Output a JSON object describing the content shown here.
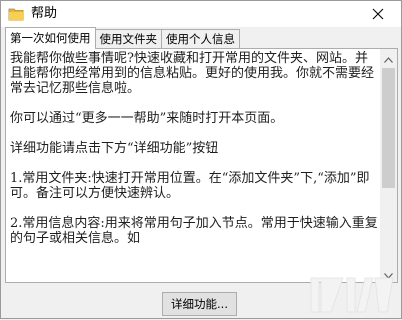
{
  "window": {
    "title": "帮助",
    "icon": "folder-icon"
  },
  "tabs": [
    {
      "label": "第一次如何使用",
      "active": true
    },
    {
      "label": "使用文件夹",
      "active": false
    },
    {
      "label": "使用个人信息",
      "active": false
    }
  ],
  "content": {
    "paragraphs": [
      "我能帮你做些事情呢?快速收藏和打开常用的文件夹、网站。并且能帮你把经常用到的信息粘贴。更好的使用我。你就不需要经常去记忆那些信息啦。",
      "你可以通过“更多一一帮助”来随时打开本页面。",
      "详细功能请点击下方“详细功能”按钮",
      "1.常用文件夹:快速打开常用位置。在“添加文件夹”下,“添加”即可。备注可以方便快速辨认。",
      "2.常用信息内容:用来将常用句子加入节点。常用于快速输入重复的句子或相关信息。如"
    ]
  },
  "buttons": {
    "details": "详细功能..."
  },
  "colors": {
    "window_bg": "#f0f0f0",
    "panel_bg": "#ffffff",
    "watermark": "#f3f3f3"
  }
}
